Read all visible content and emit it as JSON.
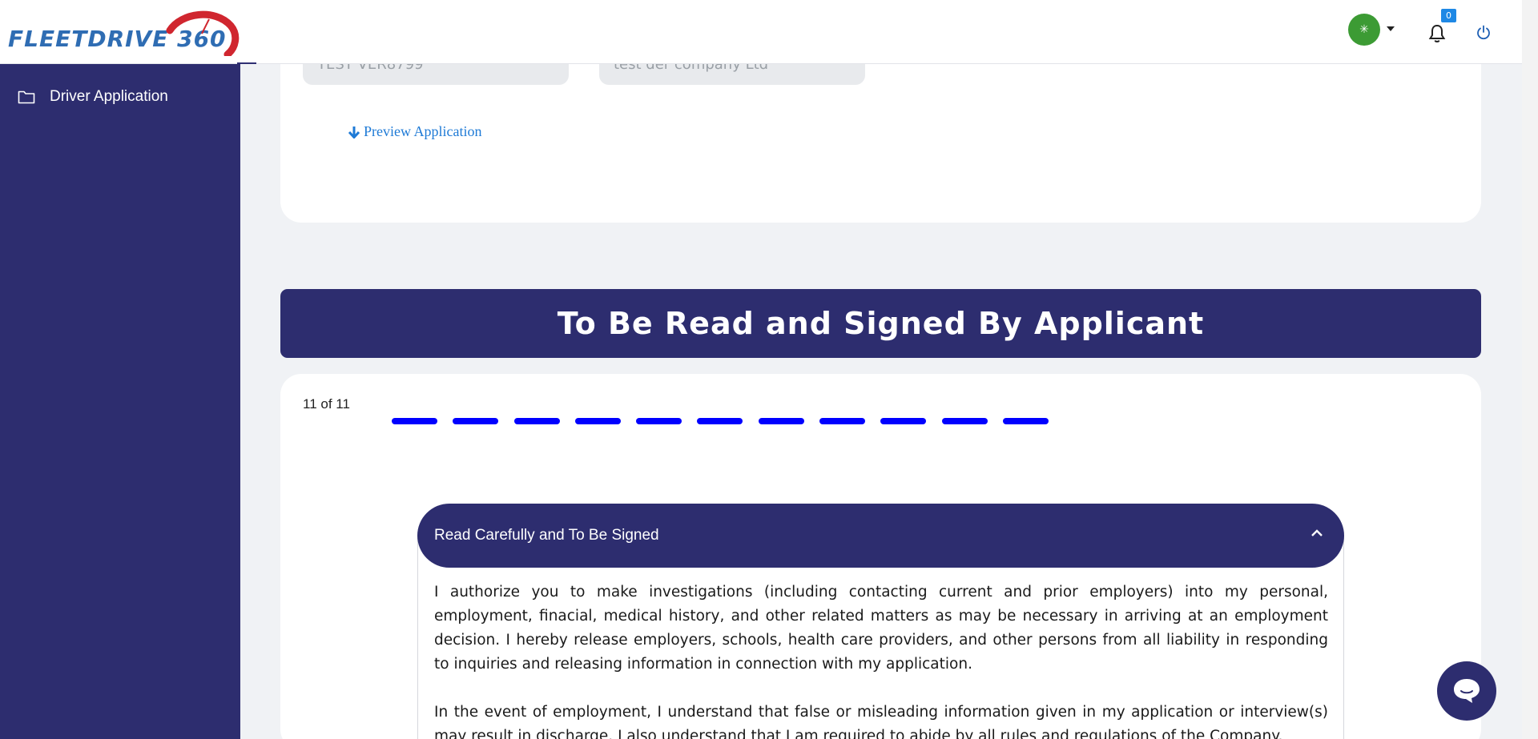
{
  "brand": {
    "logo_text": "FLEETDRIVE 360"
  },
  "header": {
    "avatar_glyph": "✳",
    "notifications_count": "0"
  },
  "sidebar": {
    "items": [
      {
        "label": "Driver Application",
        "icon": "folder-icon"
      }
    ]
  },
  "top_card": {
    "field1_value": "TEST VER8799",
    "field2_value": "test der company Ltd",
    "preview_label": "Preview Application"
  },
  "section": {
    "title": "To Be Read and Signed By Applicant"
  },
  "progress": {
    "label": "11 of 11",
    "current": 11,
    "total": 11
  },
  "accordion": {
    "title": "Read Carefully and To Be Signed",
    "paragraphs": [
      "I authorize you to make investigations (including contacting current and prior employers) into my personal, employment, finacial, medical history, and other related matters as may be necessary in arriving at an employment decision. I hereby release employers, schools, health care providers, and other persons from all liability in responding to inquiries and releasing information in connection with my application.",
      "In the event of employment, I understand that false or misleading information given in my application or interview(s) may result in discharge. I also understand that I am required to abide by all rules and regulations of the Company."
    ]
  },
  "colors": {
    "navy": "#2d2d6f",
    "progress": "#0000ff",
    "link": "#1e7ad6",
    "avatar": "#3c9b34",
    "badge": "#1e88e5"
  }
}
